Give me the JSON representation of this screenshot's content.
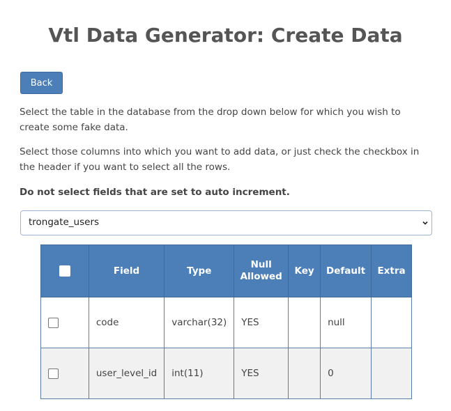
{
  "page": {
    "title": "Vtl Data Generator: Create Data"
  },
  "back_button": {
    "label": "Back"
  },
  "instructions": {
    "para1": "Select the table in the database from the drop down below for which you wish to create some fake data.",
    "para2": "Select those columns into which you want to add data, or just check the checkbox in the header if you want to select all the rows.",
    "warning": "Do not select fields that are set to auto increment."
  },
  "table_select": {
    "selected": "trongate_users",
    "icon": "chevron-down-icon"
  },
  "fields_table": {
    "headers": {
      "select_all_checked": false,
      "field": "Field",
      "type": "Type",
      "null_allowed_line1": "Null",
      "null_allowed_line2": "Allowed",
      "key": "Key",
      "default": "Default",
      "extra": "Extra"
    },
    "rows": [
      {
        "checked": false,
        "field": "code",
        "type": "varchar(32)",
        "null": "YES",
        "key": "",
        "default": "null",
        "extra": ""
      },
      {
        "checked": false,
        "field": "user_level_id",
        "type": "int(11)",
        "null": "YES",
        "key": "",
        "default": "0",
        "extra": ""
      }
    ]
  },
  "colors": {
    "accent": "#4c7fb8",
    "header_text": "#ffffff",
    "alt_row": "#f1f1f1",
    "title_text": "#555555"
  }
}
